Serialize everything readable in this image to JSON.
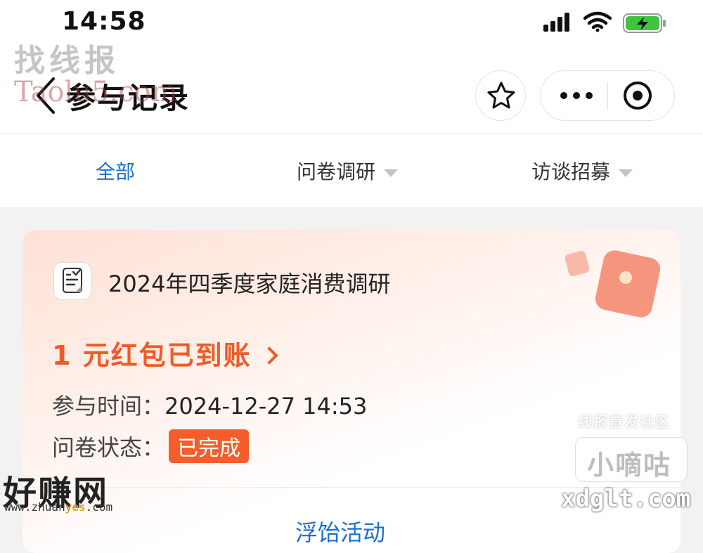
{
  "status_bar": {
    "time": "14:58"
  },
  "nav": {
    "title": "参与记录"
  },
  "tabs": [
    {
      "label": "全部",
      "active": true
    },
    {
      "label": "问卷调研",
      "has_dropdown": true
    },
    {
      "label": "访谈招募",
      "has_dropdown": true
    }
  ],
  "record": {
    "title": "2024年四季度家庭消费调研",
    "reward": "1 元红包已到账",
    "time_label": "参与时间：",
    "time_value": "2024-12-27 14:53",
    "status_label": "问卷状态：",
    "status_value": "已完成",
    "bottom_link": "浮饴活动"
  },
  "watermarks": {
    "top_text": "找线报",
    "top_url": "Taolu5.com",
    "community": "线报首发社区",
    "brand": "小嘀咕",
    "domain": "xdglt.com",
    "logo": "好赚网",
    "logo_url_prefix": "www.zhuan",
    "logo_url_mid": "yes",
    "logo_url_suffix": ".com"
  },
  "colors": {
    "accent_blue": "#1a6fd1",
    "reward_orange": "#ef5b28",
    "badge_orange": "#f55d2c",
    "battery_green": "#3ec43e"
  },
  "icons": [
    "signal-icon",
    "wifi-icon",
    "battery-charging-icon",
    "back-chevron-icon",
    "star-icon",
    "more-dots-icon",
    "close-target-icon",
    "questionnaire-icon",
    "red-envelope-icon",
    "chevron-right-icon"
  ]
}
